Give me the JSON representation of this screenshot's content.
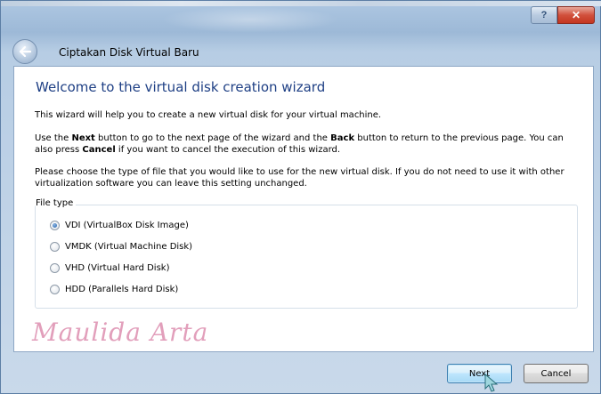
{
  "window": {
    "title": "Ciptakan Disk Virtual Baru",
    "help_glyph": "?",
    "close_glyph": "✕"
  },
  "wizard": {
    "heading": "Welcome to the virtual disk creation wizard",
    "intro": "This wizard will help you to create a new virtual disk for your virtual machine.",
    "nav_help": {
      "part1": "Use the ",
      "next_word": "Next",
      "part2": " button to go to the next page of the wizard and the ",
      "back_word": "Back",
      "part3": " button to return to the previous page. You can also press ",
      "cancel_word": "Cancel",
      "part4": " if you want to cancel the execution of this wizard."
    },
    "choose_text": "Please choose the type of file that you would like to use for the new virtual disk. If you do not need to use it with other virtualization software you can leave this setting unchanged.",
    "file_type_label": "File type",
    "file_types": [
      {
        "label": "VDI (VirtualBox Disk Image)",
        "checked": true
      },
      {
        "label": "VMDK (Virtual Machine Disk)",
        "checked": false
      },
      {
        "label": "VHD (Virtual Hard Disk)",
        "checked": false
      },
      {
        "label": "HDD (Parallels Hard Disk)",
        "checked": false
      }
    ],
    "watermark": "Maulida Arta"
  },
  "buttons": {
    "next_label": "Next",
    "cancel_label": "Cancel"
  },
  "colors": {
    "heading": "#1e3f84",
    "watermark": "#e29fbb",
    "close_button": "#c43520"
  }
}
